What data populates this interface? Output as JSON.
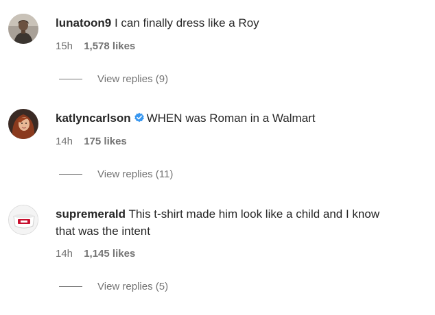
{
  "comments": [
    {
      "username": "lunatoon9",
      "verified": false,
      "text": "I can finally dress like a Roy",
      "time": "15h",
      "likes": "1,578 likes",
      "replies": "View replies (9)",
      "avatar_icon": "profile-photo-man-dark"
    },
    {
      "username": "katlyncarlson",
      "verified": true,
      "text": "WHEN was Roman in a Walmart",
      "time": "14h",
      "likes": "175 likes",
      "replies": "View replies (11)",
      "avatar_icon": "profile-photo-woman-red-hair"
    },
    {
      "username": "supremerald",
      "verified": false,
      "text_line1": "This t-shirt made him look like a child and I know",
      "text_line2": "that was the intent",
      "time": "14h",
      "likes": "1,145 likes",
      "replies": "View replies (5)",
      "avatar_icon": "profile-photo-white-bowl-red-logo"
    }
  ],
  "colors": {
    "text": "#262626",
    "secondary": "#737373",
    "verified_badge": "#3897f0"
  }
}
